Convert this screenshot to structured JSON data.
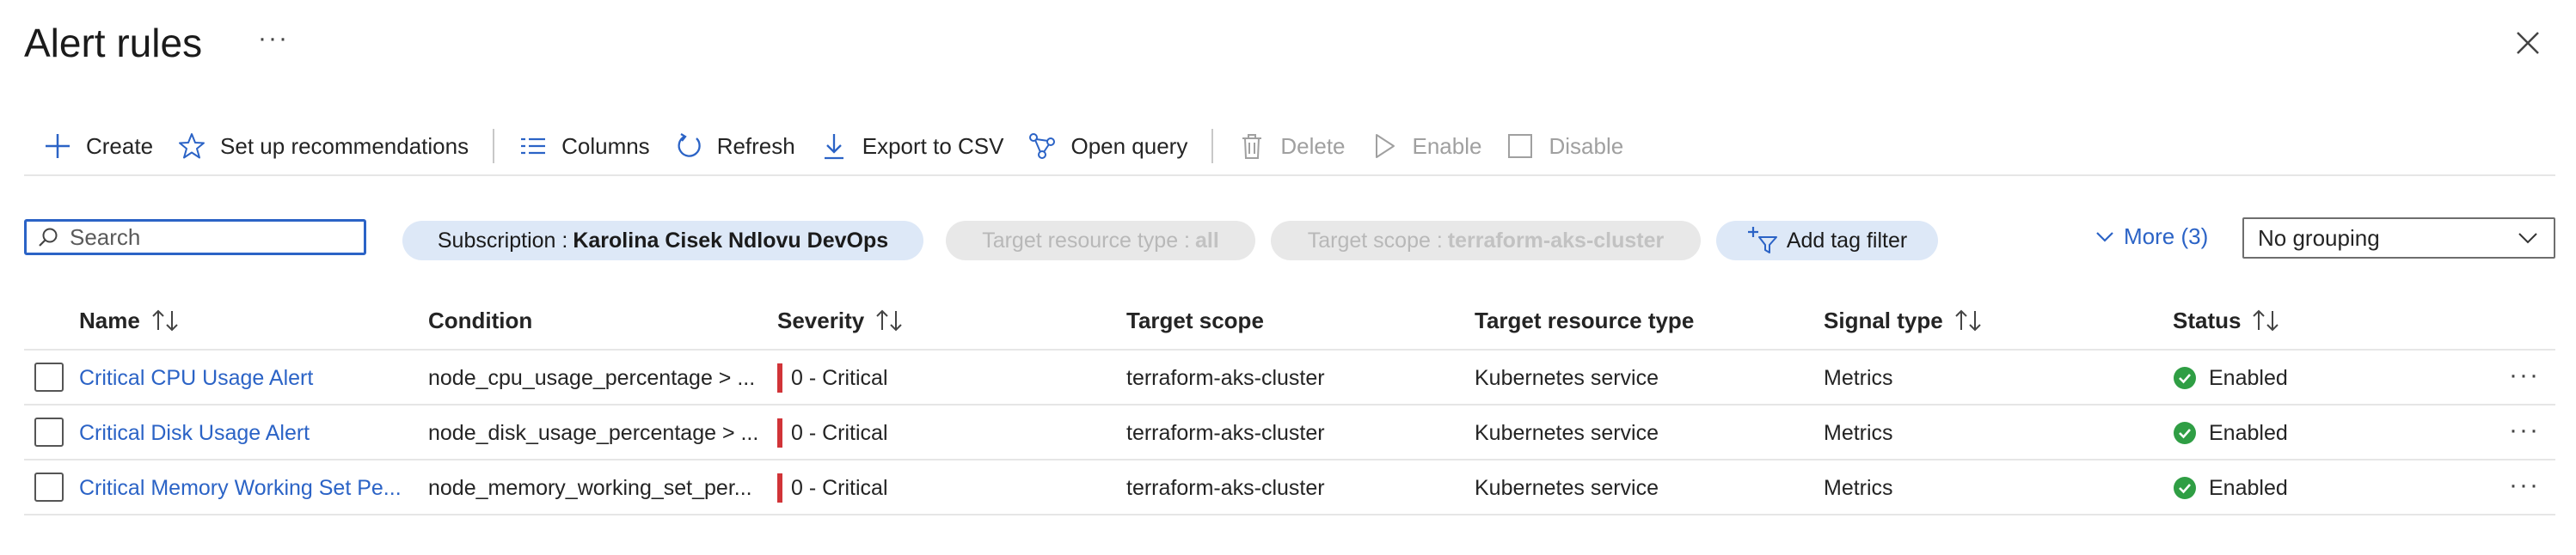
{
  "page": {
    "title": "Alert rules",
    "more_glyph": "···"
  },
  "toolbar": {
    "create": "Create",
    "setup": "Set up recommendations",
    "columns": "Columns",
    "refresh": "Refresh",
    "export": "Export to CSV",
    "open_query": "Open query",
    "delete": "Delete",
    "enable": "Enable",
    "disable": "Disable"
  },
  "filters": {
    "search_placeholder": "Search",
    "subscription_label": "Subscription : ",
    "subscription_value": "Karolina Cisek Ndlovu DevOps",
    "resource_type_label": "Target resource type : ",
    "resource_type_value": "all",
    "scope_label": "Target scope : ",
    "scope_value": "terraform-aks-cluster",
    "add_tag": "Add tag filter",
    "more": "More (3)",
    "grouping": "No grouping"
  },
  "table": {
    "headers": {
      "name": "Name",
      "condition": "Condition",
      "severity": "Severity",
      "target_scope": "Target scope",
      "target_type": "Target resource type",
      "signal": "Signal type",
      "status": "Status"
    },
    "rows": [
      {
        "name": "Critical CPU Usage Alert",
        "condition": "node_cpu_usage_percentage > ...",
        "severity": "0 - Critical",
        "target_scope": "terraform-aks-cluster",
        "target_type": "Kubernetes service",
        "signal": "Metrics",
        "status": "Enabled"
      },
      {
        "name": "Critical Disk Usage Alert",
        "condition": "node_disk_usage_percentage > ...",
        "severity": "0 - Critical",
        "target_scope": "terraform-aks-cluster",
        "target_type": "Kubernetes service",
        "signal": "Metrics",
        "status": "Enabled"
      },
      {
        "name": "Critical Memory Working Set Pe...",
        "condition": "node_memory_working_set_per...",
        "severity": "0 - Critical",
        "target_scope": "terraform-aks-cluster",
        "target_type": "Kubernetes service",
        "signal": "Metrics",
        "status": "Enabled"
      }
    ],
    "row_more_glyph": "···"
  },
  "colors": {
    "accent": "#2b63c6",
    "critical": "#d13438",
    "enabled": "#2f9e44"
  }
}
